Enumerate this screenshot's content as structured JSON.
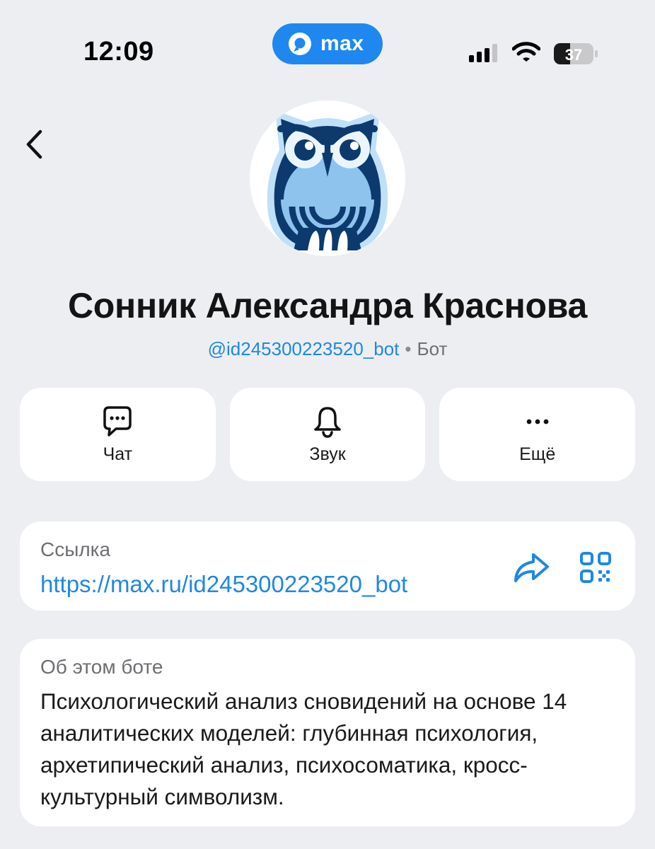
{
  "status_bar": {
    "time": "12:09",
    "app_pill_label": "max",
    "battery_level": "37",
    "signal_bars_active": 3,
    "signal_bars_total": 4
  },
  "profile": {
    "name": "Сонник Александра Краснова",
    "username": "@id245300223520_bot",
    "separator": "•",
    "type": "Бот"
  },
  "actions": [
    {
      "label": "Чат",
      "icon": "chat-icon"
    },
    {
      "label": "Звук",
      "icon": "bell-icon"
    },
    {
      "label": "Ещё",
      "icon": "more-icon"
    }
  ],
  "link": {
    "title": "Ссылка",
    "url": "https://max.ru/id245300223520_bot",
    "share_icon": "share-icon",
    "qr_icon": "qr-code-icon"
  },
  "about": {
    "title": "Об этом боте",
    "text": "Психологический анализ сновидений на основе 14 аналитических моделей: глубинная психология, архетипический анализ, психосоматика, кросс-культурный символизм."
  },
  "colors": {
    "background": "#EDEEF2",
    "accent": "#1E88E5",
    "pill": "#1E88F0",
    "owl_dark": "#0D3A6E",
    "owl_light": "#8EC3EE"
  }
}
